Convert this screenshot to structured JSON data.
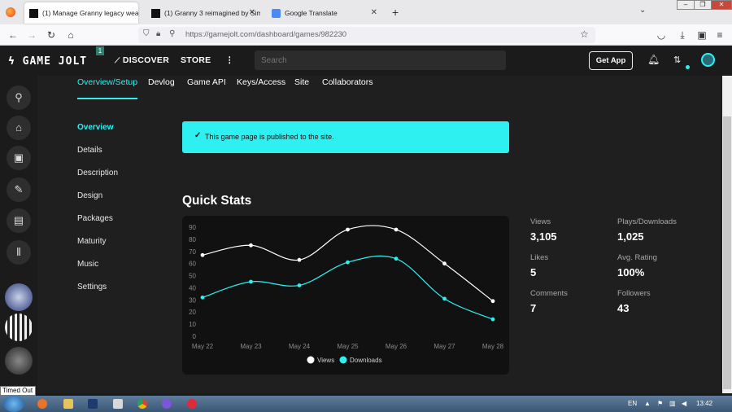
{
  "browser": {
    "tabs": [
      {
        "title": "(1) Manage Granny legacy weap",
        "active": true
      },
      {
        "title": "(1) Granny 3 reimagined by Sim",
        "active": false
      },
      {
        "title": "Google Translate",
        "active": false
      }
    ],
    "new_tab": "+",
    "url": "https://gamejolt.com/dashboard/games/982230"
  },
  "header": {
    "logo": "GAME JOLT",
    "logo_badge": "1",
    "discover": "DISCOVER",
    "store": "STORE",
    "more": "⋮",
    "search_placeholder": "Search",
    "get_app": "Get App"
  },
  "subnav": {
    "tabs": [
      "Overview/Setup",
      "Devlog",
      "Game API",
      "Keys/Access",
      "Site",
      "Collaborators"
    ]
  },
  "sidebar": {
    "items": [
      "Overview",
      "Details",
      "Description",
      "Design",
      "Packages",
      "Maturity",
      "Music",
      "Settings"
    ]
  },
  "alert": {
    "text": "This game page is published to the site."
  },
  "quick_stats": {
    "title": "Quick Stats",
    "stats": [
      {
        "label": "Views",
        "value": "3,105"
      },
      {
        "label": "Plays/Downloads",
        "value": "1,025"
      },
      {
        "label": "Likes",
        "value": "5"
      },
      {
        "label": "Avg. Rating",
        "value": "100%"
      },
      {
        "label": "Comments",
        "value": "7"
      },
      {
        "label": "Followers",
        "value": "43"
      }
    ]
  },
  "chart_data": {
    "type": "line",
    "x": [
      "May 22",
      "May 23",
      "May 24",
      "May 25",
      "May 26",
      "May 27",
      "May 28"
    ],
    "yticks": [
      0,
      10,
      20,
      30,
      40,
      50,
      60,
      70,
      80,
      90
    ],
    "ylim": [
      0,
      90
    ],
    "series": [
      {
        "name": "Views",
        "values": [
          67,
          75,
          63,
          88,
          88,
          60,
          29
        ],
        "color": "#ffffff"
      },
      {
        "name": "Downloads",
        "values": [
          32,
          45,
          42,
          61,
          64,
          31,
          14
        ],
        "color": "#2ff0f0"
      }
    ],
    "legend_position": "bottom"
  },
  "taskbar": {
    "tooltip": "Timed Out",
    "lang": "EN",
    "clock": "13:42"
  },
  "colors": {
    "accent": "#2ff0f0",
    "bg": "#1f1f1f"
  }
}
